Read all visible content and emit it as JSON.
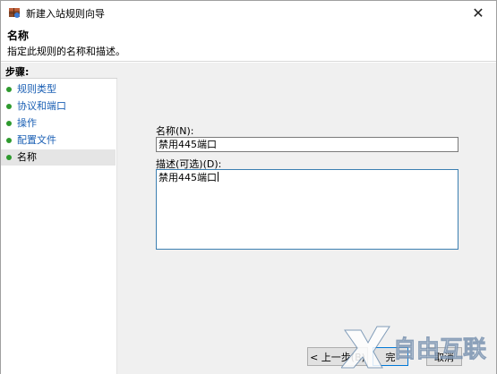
{
  "window": {
    "title": "新建入站规则向导",
    "close_glyph": "✕"
  },
  "header": {
    "title": "名称",
    "description": "指定此规则的名称和描述。"
  },
  "steps": {
    "heading": "步骤:",
    "items": [
      {
        "label": "规则类型"
      },
      {
        "label": "协议和端口"
      },
      {
        "label": "操作"
      },
      {
        "label": "配置文件"
      },
      {
        "label": "名称"
      }
    ]
  },
  "form": {
    "name_label": "名称(N):",
    "name_value": "禁用445端口",
    "desc_label": "描述(可选)(D):",
    "desc_value": "禁用445端口"
  },
  "buttons": {
    "back": "< 上一步(B)",
    "next": "完",
    "cancel": "取消"
  },
  "colors": {
    "step_dot": "#2e9a2e",
    "link": "#1a5fb4",
    "accent": "#0078d7"
  },
  "icons": {
    "title": "firewall-icon",
    "step": "green-dot-icon",
    "close": "close-icon"
  },
  "watermark": "自由互联"
}
